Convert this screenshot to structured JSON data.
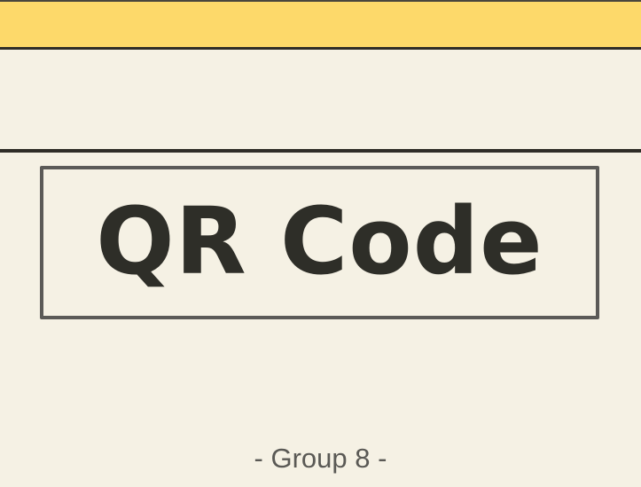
{
  "slide": {
    "title": "QR Code",
    "footer": "- Group 8 -"
  },
  "colors": {
    "background": "#f5f1e4",
    "top_band": "#fdd96a",
    "rule": "#2f2d27",
    "box_border": "#5b5a57",
    "title_text": "#2e2e28",
    "footer_text": "#5a5955"
  }
}
